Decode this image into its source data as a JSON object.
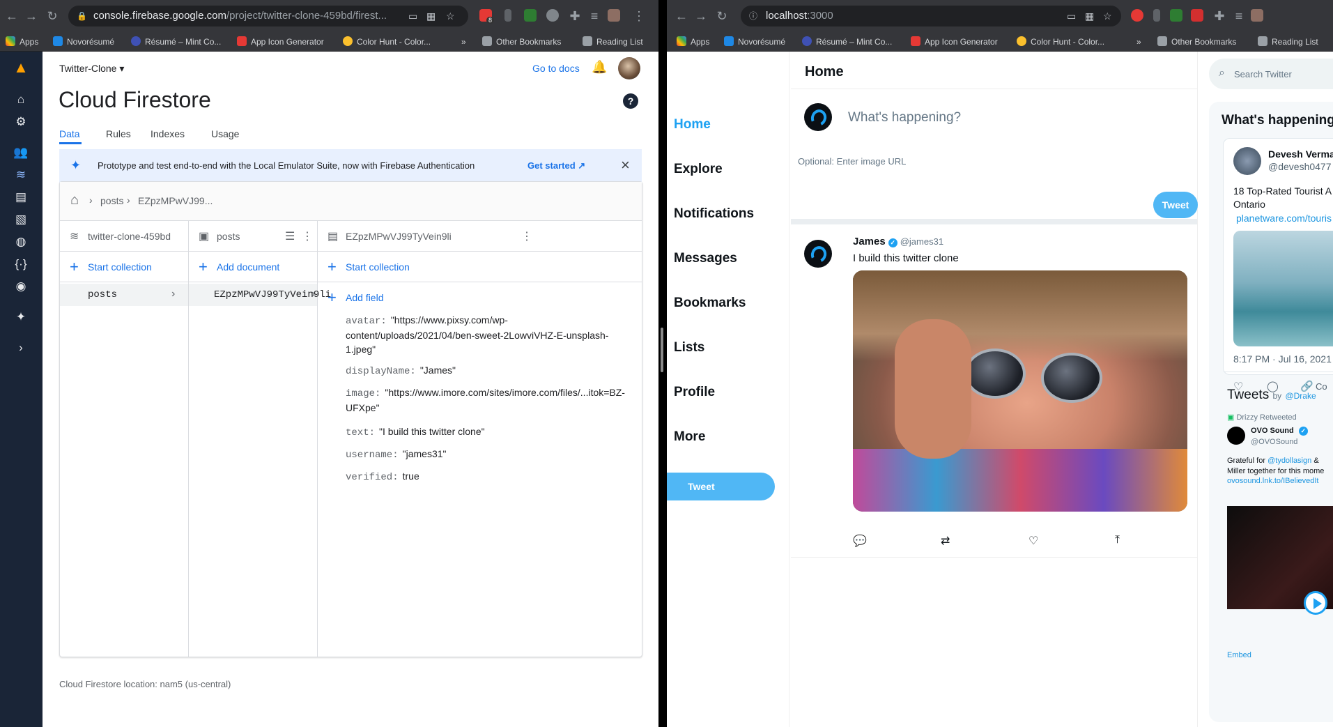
{
  "left_browser": {
    "url_host": "console.firebase.google.com",
    "url_path": "/project/twitter-clone-459bd/firest...",
    "ext_badge": "8",
    "bookmarks": [
      "Apps",
      "Novorésumé",
      "Résumé – Mint Co...",
      "App Icon Generator",
      "Color Hunt - Color...",
      "»",
      "Other Bookmarks",
      "Reading List"
    ]
  },
  "right_browser": {
    "url_host": "localhost",
    "url_path": ":3000",
    "bookmarks": [
      "Apps",
      "Novorésumé",
      "Résumé – Mint Co...",
      "App Icon Generator",
      "Color Hunt - Color...",
      "»",
      "Other Bookmarks",
      "Reading List"
    ]
  },
  "firebase": {
    "project": "Twitter-Clone",
    "go_to_docs": "Go to docs",
    "title": "Cloud Firestore",
    "tabs": [
      "Data",
      "Rules",
      "Indexes",
      "Usage"
    ],
    "banner": {
      "message": "Prototype and test end-to-end with the Local Emulator Suite, now with Firebase Authentication",
      "cta": "Get started"
    },
    "breadcrumb": [
      "posts",
      "EZpzMPwVJ99..."
    ],
    "col1": {
      "header": "twitter-clone-459bd",
      "action": "Start collection",
      "item": "posts"
    },
    "col2": {
      "header": "posts",
      "action": "Add document",
      "item": "EZpzMPwVJ99TyVein9li"
    },
    "col3": {
      "header": "EZpzMPwVJ99TyVein9li",
      "action": "Start collection",
      "add_field": "Add field",
      "fields": [
        {
          "key": "avatar:",
          "value": "\"https://www.pixsy.com/wp-content/uploads/2021/04/ben-sweet-2LowviVHZ-E-unsplash-1.jpeg\""
        },
        {
          "key": "displayName:",
          "value": "\"James\""
        },
        {
          "key": "image:",
          "value": "\"https://www.imore.com/sites/imore.com/files/...itok=BZ-UFXpe\""
        },
        {
          "key": "text:",
          "value": "\"I build this twitter clone\""
        },
        {
          "key": "username:",
          "value": "\"james31\""
        },
        {
          "key": "verified:",
          "value": "true"
        }
      ]
    },
    "location": "Cloud Firestore location: nam5 (us-central)"
  },
  "twitter": {
    "nav": [
      "Home",
      "Explore",
      "Notifications",
      "Messages",
      "Bookmarks",
      "Lists",
      "Profile",
      "More"
    ],
    "nav_tweet": "Tweet",
    "feed_title": "Home",
    "composer_placeholder": "What's happening?",
    "image_url_placeholder": "Optional: Enter image URL",
    "composer_button": "Tweet",
    "post": {
      "name": "James",
      "handle": "@james31",
      "text": "I build this twitter clone"
    },
    "search_placeholder": "Search Twitter",
    "trends_title": "What's happening",
    "embed_card": {
      "name": "Devesh Verma",
      "handle": "@devesh0477",
      "text_line1": "18 Top-Rated Tourist A",
      "text_line2": "Ontario",
      "link": "planetware.com/touris",
      "timestamp": "8:17 PM · Jul 16, 2021",
      "copy": "Co"
    },
    "timeline": {
      "title": "Tweets",
      "by": "by",
      "by_handle": "@Drake",
      "retweeted": "Drizzy Retweeted",
      "name": "OVO Sound",
      "handle": "@OVOSound",
      "text_prefix": "Grateful for",
      "mention": "@tydollasign",
      "text_suffix": "&",
      "text_line2": "Miller together for this mome",
      "link": "ovosound.lnk.to/IBelievedIt",
      "embed": "Embed"
    }
  }
}
